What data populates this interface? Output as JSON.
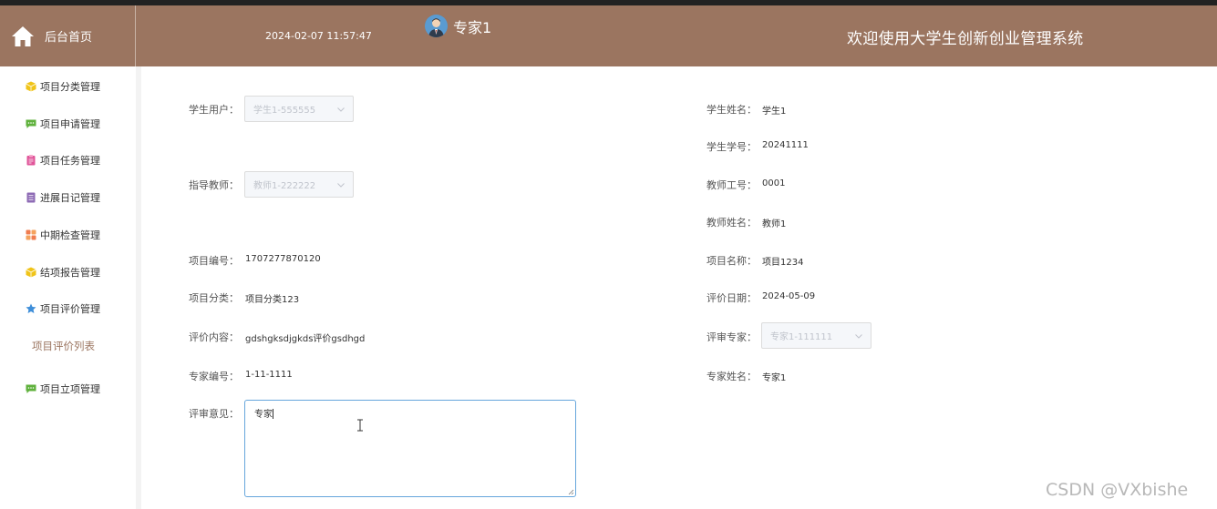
{
  "header": {
    "home_label": "后台首页",
    "datetime": "2024-02-07 11:57:47",
    "user_name": "专家1",
    "system_title": "欢迎使用大学生创新创业管理系统"
  },
  "sidebar": {
    "items": [
      {
        "label": "项目分类管理",
        "icon": "cube-icon",
        "color": "#f0c419"
      },
      {
        "label": "项目申请管理",
        "icon": "chat-icon",
        "color": "#5fb13c"
      },
      {
        "label": "项目任务管理",
        "icon": "clipboard-icon",
        "color": "#e0569a"
      },
      {
        "label": "进展日记管理",
        "icon": "notebook-icon",
        "color": "#8e6bb5"
      },
      {
        "label": "中期检查管理",
        "icon": "grid-icon",
        "color": "#f07c4f"
      },
      {
        "label": "结项报告管理",
        "icon": "cube-icon",
        "color": "#f0c419"
      },
      {
        "label": "项目评价管理",
        "icon": "star-badge-icon",
        "color": "#3e8ed9"
      },
      {
        "label": "项目立项管理",
        "icon": "chat-icon",
        "color": "#5fb13c"
      }
    ],
    "active_sub": "项目评价列表"
  },
  "form": {
    "student_user_label": "学生用户：",
    "student_user_value": "学生1-555555",
    "student_name_label": "学生姓名：",
    "student_name_value": "学生1",
    "student_no_label": "学生学号：",
    "student_no_value": "20241111",
    "teacher_label": "指导教师：",
    "teacher_value": "教师1-222222",
    "teacher_no_label": "教师工号：",
    "teacher_no_value": "0001",
    "teacher_name_label": "教师姓名：",
    "teacher_name_value": "教师1",
    "project_no_label": "项目编号：",
    "project_no_value": "1707277870120",
    "project_name_label": "项目名称：",
    "project_name_value": "项目1234",
    "project_cat_label": "项目分类：",
    "project_cat_value": "项目分类123",
    "eval_date_label": "评价日期：",
    "eval_date_value": "2024-05-09",
    "eval_content_label": "评价内容：",
    "eval_content_value": "gdshgksdjgkds评价gsdhgd",
    "reviewer_label": "评审专家：",
    "reviewer_value": "专家1-111111",
    "expert_no_label": "专家编号：",
    "expert_no_value": "1-11-1111",
    "expert_name_label": "专家姓名：",
    "expert_name_value": "专家1",
    "opinion_label": "评审意见：",
    "opinion_value": "专家"
  },
  "watermark": "CSDN @VXbishe",
  "colors": {
    "header_bg": "#9b7560",
    "accent": "#9b7560",
    "focus_border": "#66a6dc"
  }
}
